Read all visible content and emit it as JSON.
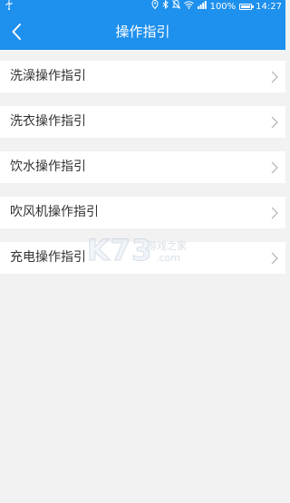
{
  "status_bar": {
    "usb_icon": "usb-icon",
    "battery_percent": "100%",
    "time": "14:27",
    "icons": [
      "location-icon",
      "bluetooth-icon",
      "mute-icon",
      "wifi-icon",
      "signal-icon",
      "battery-icon"
    ]
  },
  "nav": {
    "title": "操作指引",
    "back_icon": "chevron-left-icon"
  },
  "list": {
    "items": [
      {
        "label": "洗澡操作指引"
      },
      {
        "label": "洗衣操作指引"
      },
      {
        "label": "饮水操作指引"
      },
      {
        "label": "吹风机操作指引"
      },
      {
        "label": "充电操作指引"
      }
    ]
  },
  "watermark": {
    "logo": "K73",
    "text_cn": "游戏之家",
    "text_domain": ".com"
  },
  "colors": {
    "primary": "#1e90ee",
    "background": "#f2f2f2",
    "item_bg": "#ffffff",
    "text": "#333333",
    "chevron": "#b0b0b0"
  }
}
